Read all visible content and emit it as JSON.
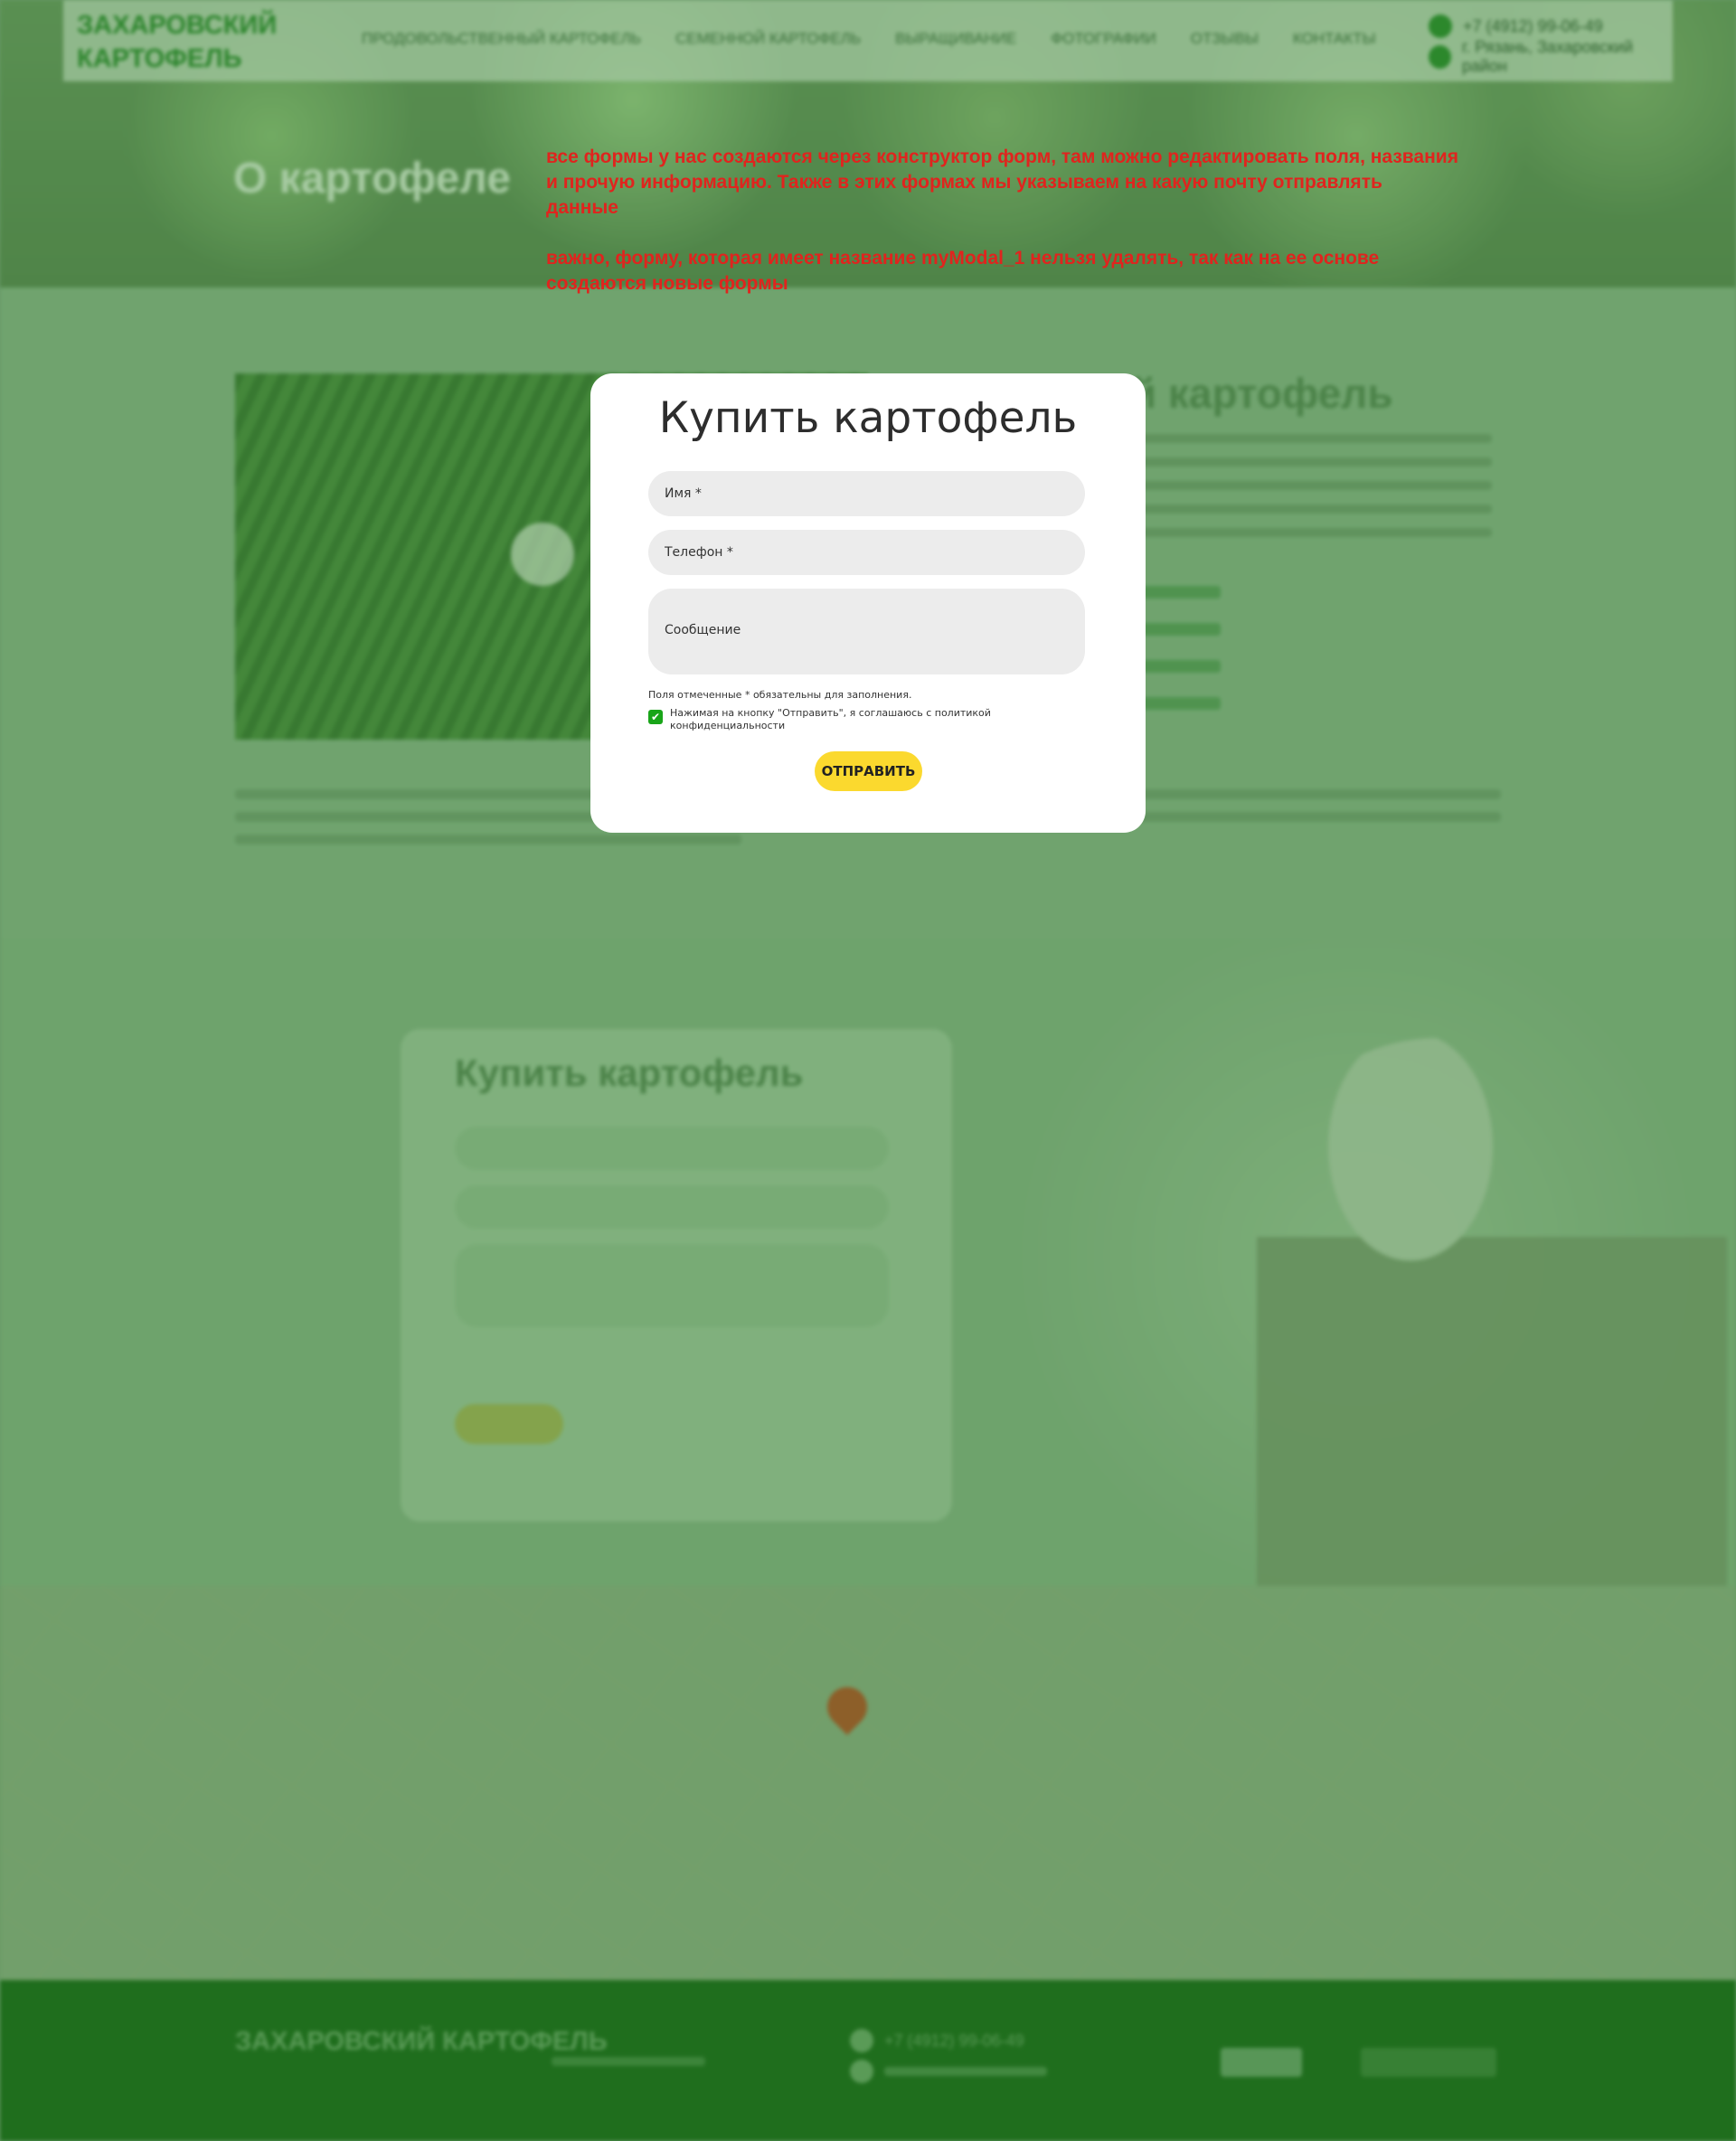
{
  "header": {
    "logo": "ЗАХАРОВСКИЙ КАРТОФЕЛЬ",
    "menu": [
      "Продовольственный картофель",
      "Семенной картофель",
      "Выращивание",
      "Фотографии",
      "Отзывы",
      "Контакты"
    ],
    "phone": "+7 (4912) 99-06-49",
    "address": "г. Рязань, Захаровский район"
  },
  "hero": {
    "title": "О картофеле"
  },
  "note": {
    "line1": "все формы у нас создаются через конструктор форм, там можно редактировать поля, названия и прочую информацию. Также в этих формах мы указываем на какую почту отправлять данные",
    "line2": "важно, форму, которая имеет название myModal_1 нельзя удалять, так как на ее основе создаются новые формы"
  },
  "about": {
    "heading": "Захаровский картофель"
  },
  "bg_form": {
    "title": "Купить картофель"
  },
  "modal": {
    "title": "Купить картофель",
    "name_placeholder": "Имя *",
    "phone_placeholder": "Телефон *",
    "message_placeholder": "Сообщение",
    "required_note": "Поля отмеченные * обязательны для заполнения.",
    "consent_checked": true,
    "consent_text": "Нажимая на кнопку \"Отправить\", я соглашаюсь с политикой конфиденциальности",
    "submit_label": "ОТПРАВИТЬ"
  },
  "footer": {
    "logo": "ЗАХАРОВСКИЙ КАРТОФЕЛЬ",
    "phone": "+7 (4912) 99-06-49"
  },
  "colors": {
    "note_red": "#e0241e",
    "button_yellow": "#fbd92e",
    "check_green": "#19a519",
    "footer_green": "#1d6b1a"
  }
}
